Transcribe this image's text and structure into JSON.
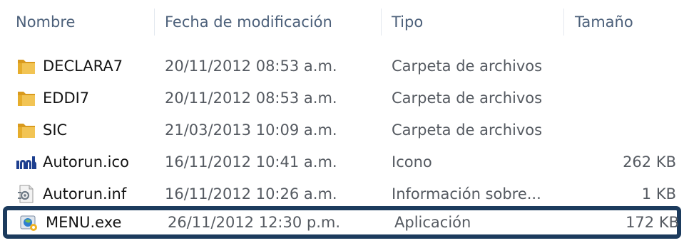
{
  "columns": {
    "name": "Nombre",
    "date": "Fecha de modificación",
    "type": "Tipo",
    "size": "Tamaño"
  },
  "files": [
    {
      "name": "DECLARA7",
      "date": "20/11/2012 08:53 a.m.",
      "type": "Carpeta de archivos",
      "size": "",
      "icon": "folder-icon"
    },
    {
      "name": "EDDI7",
      "date": "20/11/2012 08:53 a.m.",
      "type": "Carpeta de archivos",
      "size": "",
      "icon": "folder-icon"
    },
    {
      "name": "SIC",
      "date": "21/03/2013 10:09 a.m.",
      "type": "Carpeta de archivos",
      "size": "",
      "icon": "folder-icon"
    },
    {
      "name": "Autorun.ico",
      "date": "16/11/2012 10:41 a.m.",
      "type": "Icono",
      "size": "262 KB",
      "icon": "ico-file-icon"
    },
    {
      "name": "Autorun.inf",
      "date": "16/11/2012 10:26 a.m.",
      "type": "Información sobre...",
      "size": "1 KB",
      "icon": "settings-file-icon"
    },
    {
      "name": "MENU.exe",
      "date": "26/11/2012 12:30 p.m.",
      "type": "Aplicación",
      "size": "172 KB",
      "icon": "application-icon",
      "selected": true
    }
  ],
  "colors": {
    "header_text": "#4c607a",
    "selection_border": "#1c3b5d",
    "folder": "#e8b33a"
  }
}
